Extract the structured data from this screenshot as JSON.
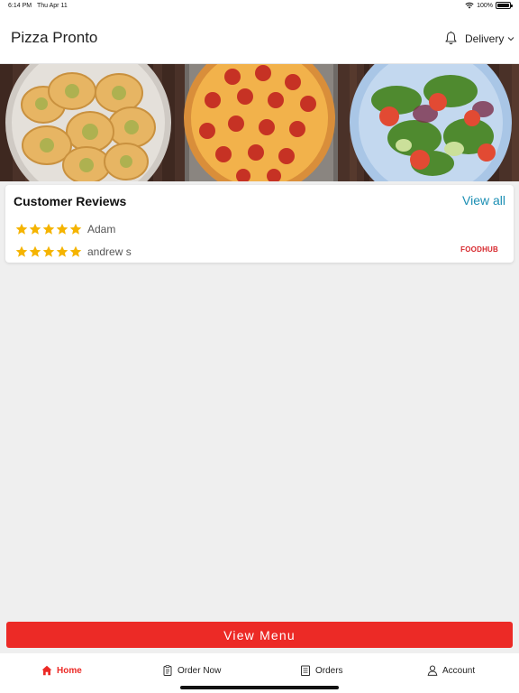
{
  "status_bar": {
    "time": "6:14 PM",
    "date": "Thu Apr 11",
    "battery": "100%",
    "battery_level": 1.0,
    "icons": [
      "wifi-icon",
      "battery-icon"
    ]
  },
  "header": {
    "title": "Pizza Pronto",
    "delivery_label": "Delivery",
    "icons": [
      "bell-icon",
      "chevron-down-icon"
    ]
  },
  "hero": {
    "items": [
      "garlic-bread",
      "pepperoni-pizza",
      "salad"
    ]
  },
  "reviews": {
    "title": "Customer Reviews",
    "view_all": "View all",
    "items": [
      {
        "name": "Adam",
        "rating": 5
      },
      {
        "name": "andrew s",
        "rating": 5
      }
    ],
    "logo": "FOODHUB"
  },
  "view_menu_label": "View Menu",
  "tabs": [
    {
      "label": "Home",
      "icon": "home-icon",
      "active": true
    },
    {
      "label": "Order Now",
      "icon": "order-icon",
      "active": false
    },
    {
      "label": "Orders",
      "icon": "orders-icon",
      "active": false
    },
    {
      "label": "Account",
      "icon": "account-icon",
      "active": false
    }
  ],
  "colors": {
    "accent": "#ec2a26",
    "link": "#1c8fb4",
    "star": "#f5b400"
  }
}
